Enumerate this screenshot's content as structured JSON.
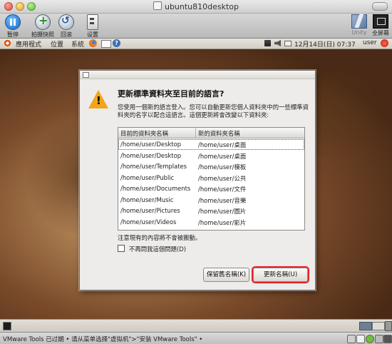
{
  "window": {
    "title": "ubuntu810desktop"
  },
  "toolbar": {
    "pause_label": "暂停",
    "snapshot_label": "拍摄快照",
    "revert_label": "回滚",
    "settings_label": "设置",
    "unity_label": "Unity",
    "fullscreen_label": "全屏幕"
  },
  "panel": {
    "menus": [
      "應用程式",
      "位置",
      "系統"
    ],
    "clock": "12月14日(日) 07:37",
    "user": "user"
  },
  "dialog": {
    "title": "更新標準資料夾至目前的語言?",
    "description": "您使用一個新的語言登入。您可以自動更新您個人資料夾中的一些標準資料夾的名字以配合這語言。這個更新將會改變以下資料夾:",
    "columns": {
      "current": "目前的資料夾名稱",
      "new": "新的資料夾名稱"
    },
    "rows": [
      {
        "current": "/home/user/Desktop",
        "new": "/home/user/桌面"
      },
      {
        "current": "/home/user/Desktop",
        "new": "/home/user/桌面"
      },
      {
        "current": "/home/user/Templates",
        "new": "/home/user/模板"
      },
      {
        "current": "/home/user/Public",
        "new": "/home/user/公共"
      },
      {
        "current": "/home/user/Documents",
        "new": "/home/user/文件"
      },
      {
        "current": "/home/user/Music",
        "new": "/home/user/音樂"
      },
      {
        "current": "/home/user/Pictures",
        "new": "/home/user/圖片"
      },
      {
        "current": "/home/user/Videos",
        "new": "/home/user/影片"
      }
    ],
    "note": "注意現有的內容將不會被搬動。",
    "checkbox_label": "不再問我這個問題(D)",
    "keep_button": "保留舊名稱(K)",
    "update_button": "更新名稱(U)"
  },
  "status": {
    "text": "VMware Tools 已过期 • 请从菜单选择\"虚拟机\">\"安装 VMware Tools\" •"
  }
}
